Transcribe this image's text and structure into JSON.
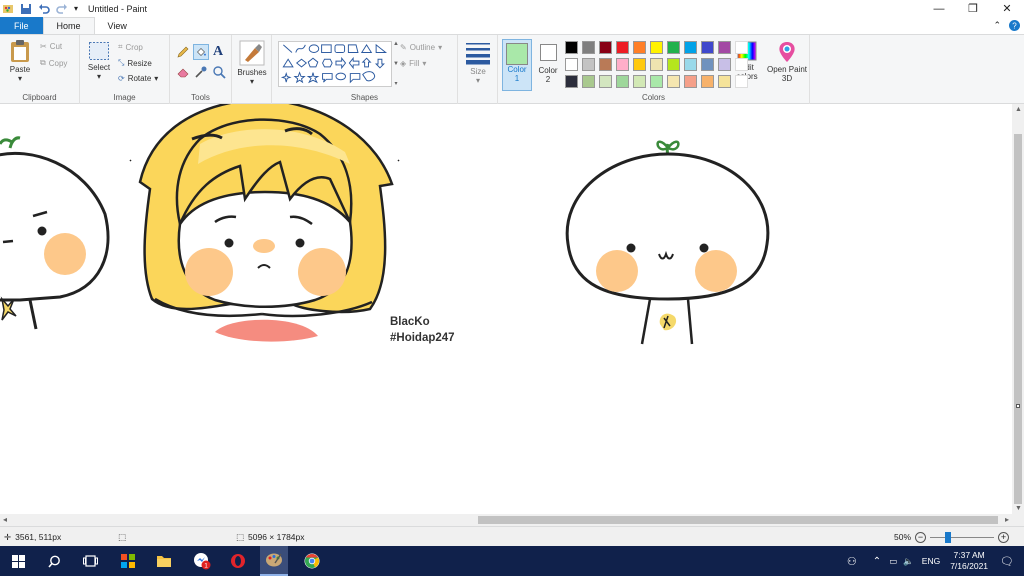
{
  "window": {
    "title": "Untitled - Paint",
    "controls": [
      "minimize",
      "restore",
      "close"
    ]
  },
  "tabs": [
    {
      "label": "File"
    },
    {
      "label": "Home"
    },
    {
      "label": "View"
    }
  ],
  "ribbon": {
    "clipboard": {
      "label": "Clipboard",
      "paste": "Paste",
      "cut": "Cut",
      "copy": "Copy"
    },
    "image": {
      "label": "Image",
      "select": "Select",
      "crop": "Crop",
      "resize": "Resize",
      "rotate": "Rotate"
    },
    "tools": {
      "label": "Tools"
    },
    "brushes": {
      "label": "Brushes"
    },
    "shapes": {
      "label": "Shapes",
      "outline": "Outline",
      "fill": "Fill"
    },
    "size": {
      "label": "Size"
    },
    "colors": {
      "label": "Colors",
      "color1": "Color\n1",
      "color1_value": "#a9e8a9",
      "color2": "Color\n2",
      "color2_value": "#ffffff",
      "edit_colors": "Edit colors",
      "palette": [
        "#000000",
        "#7f7f7f",
        "#880015",
        "#ed1c24",
        "#ff7f27",
        "#fff200",
        "#22b14c",
        "#00a2e8",
        "#3f48cc",
        "#a349a4",
        null,
        "#ffffff",
        "#c3c3c3",
        "#b97a57",
        "#ffaec9",
        "#ffc90e",
        "#efe4b0",
        "#b5e61d",
        "#99d9ea",
        "#7092be",
        "#c8bfe7",
        null,
        "#2b2d3b",
        "#a9c98f",
        "#d3e6c0",
        "#9ed79b",
        "#d2e8b5",
        "#a9e8a9",
        "#f5e6b0",
        "#f5a08a",
        "#f7b26b",
        "#f5e39a",
        null
      ]
    },
    "paint3d": {
      "label": "Open Paint 3D"
    }
  },
  "canvas": {
    "signature_line1": "BlacKo",
    "signature_line2": "#Hoidap247"
  },
  "status": {
    "cursor_pos": "3561, 511px",
    "image_size": "5096 × 1784px",
    "zoom": "50%",
    "zoom_fraction": 0.5
  },
  "taskbar": {
    "language": "ENG",
    "time": "7:37 AM",
    "date": "7/16/2021",
    "badge": "1"
  }
}
